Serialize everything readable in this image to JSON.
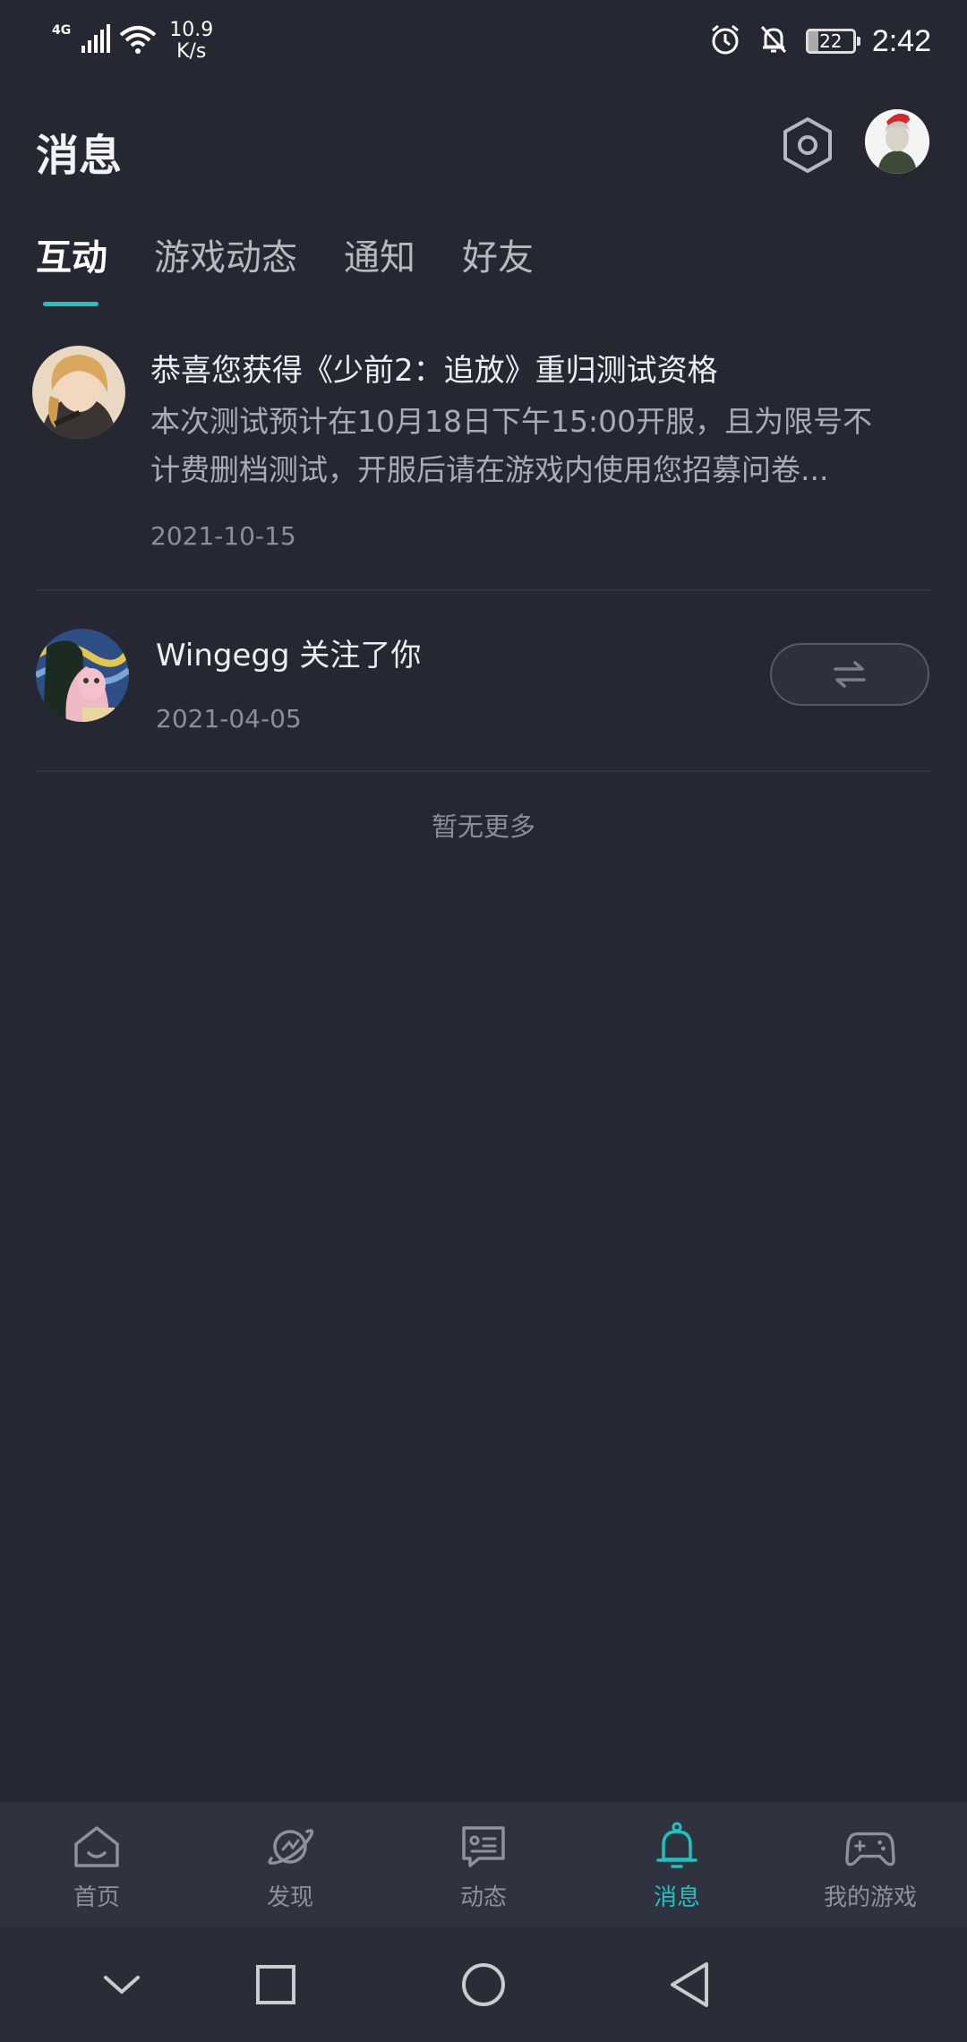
{
  "status_bar": {
    "network": "4G",
    "speed_value": "10.9",
    "speed_unit": "K/s",
    "battery": "22",
    "time": "2:42"
  },
  "header": {
    "title": "消息",
    "settings_icon": "hexagon-settings-icon",
    "avatar_icon": "user-avatar"
  },
  "tabs": [
    {
      "label": "互动",
      "active": true
    },
    {
      "label": "游戏动态",
      "active": false
    },
    {
      "label": "通知",
      "active": false
    },
    {
      "label": "好友",
      "active": false
    }
  ],
  "messages": [
    {
      "title": "恭喜您获得《少前2：追放》重归测试资格",
      "body_line1": "本次测试预计在10月18日下午15:00开服，且为限号不",
      "body_line2": "计费删档测试，开服后请在游戏内使用您招募问卷...",
      "date": "2021-10-15"
    },
    {
      "title": "Wingegg 关注了你",
      "date": "2021-04-05",
      "action_icon": "mutual-follow-icon"
    }
  ],
  "footer_text": "暂无更多",
  "bottom_nav": [
    {
      "label": "首页",
      "icon": "home-icon"
    },
    {
      "label": "发现",
      "icon": "planet-icon"
    },
    {
      "label": "动态",
      "icon": "chat-card-icon"
    },
    {
      "label": "消息",
      "icon": "bell-icon",
      "active": true
    },
    {
      "label": "我的游戏",
      "icon": "gamepad-icon"
    }
  ],
  "colors": {
    "background": "#252733",
    "accent": "#21c2c0",
    "nav_background": "#2f323f"
  }
}
